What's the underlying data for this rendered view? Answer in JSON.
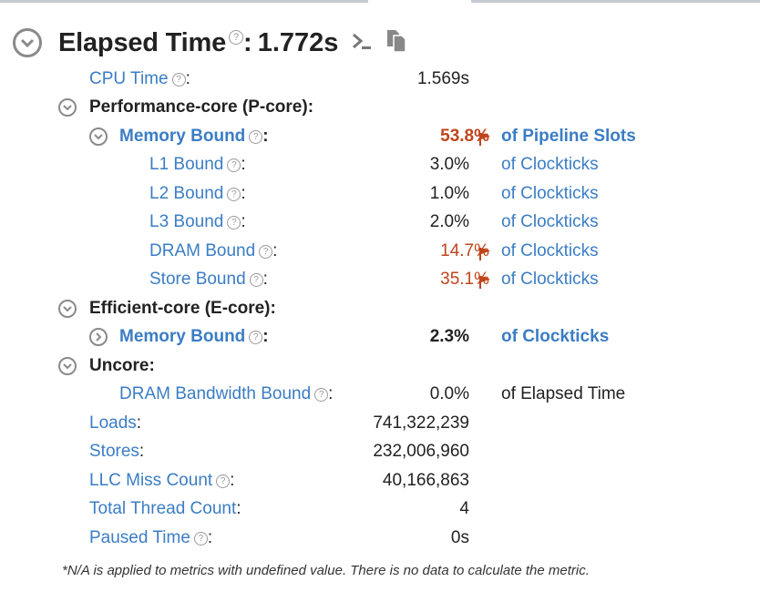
{
  "header": {
    "title": "Elapsed Time",
    "colon": ":",
    "value": "1.772s",
    "help": "?"
  },
  "rows": {
    "cpu_time": {
      "label": "CPU Time",
      "colon": ":",
      "value": "1.569s"
    },
    "pcore": {
      "label": "Performance-core (P-core):"
    },
    "pcore_mem": {
      "label": "Memory Bound",
      "colon": ":",
      "value": "53.8%",
      "unit": "of Pipeline Slots"
    },
    "l1": {
      "label": "L1 Bound",
      "colon": ":",
      "value": "3.0%",
      "unit": "of Clockticks"
    },
    "l2": {
      "label": "L2 Bound",
      "colon": ":",
      "value": "1.0%",
      "unit": "of Clockticks"
    },
    "l3": {
      "label": "L3 Bound",
      "colon": ":",
      "value": "2.0%",
      "unit": "of Clockticks"
    },
    "dram": {
      "label": "DRAM Bound",
      "colon": ":",
      "value": "14.7%",
      "unit": "of Clockticks"
    },
    "store": {
      "label": "Store Bound",
      "colon": ":",
      "value": "35.1%",
      "unit": "of Clockticks"
    },
    "ecore": {
      "label": "Efficient-core (E-core):"
    },
    "ecore_mem": {
      "label": "Memory Bound",
      "colon": ":",
      "value": "2.3%",
      "unit": "of Clockticks"
    },
    "uncore": {
      "label": "Uncore:"
    },
    "dram_bw": {
      "label": "DRAM Bandwidth Bound",
      "colon": ":",
      "value": "0.0%",
      "unit": "of Elapsed Time"
    },
    "loads": {
      "label": "Loads",
      "colon": ":",
      "value": "741,322,239"
    },
    "stores": {
      "label": "Stores",
      "colon": ":",
      "value": "232,006,960"
    },
    "llc": {
      "label": "LLC Miss Count",
      "colon": ":",
      "value": "40,166,863"
    },
    "threads": {
      "label": "Total Thread Count",
      "colon": ":",
      "value": "4"
    },
    "paused": {
      "label": "Paused Time",
      "colon": ":",
      "value": "0s"
    }
  },
  "footnote": "*N/A is applied to metrics with undefined value. There is no data to calculate the metric.",
  "colors": {
    "link": "#3b7dc4",
    "warning": "#c0441b",
    "text": "#222222"
  },
  "icons": [
    "collapse-chevron-icon",
    "help-icon",
    "terminal-icon",
    "copy-icon",
    "expand-chevron-icon",
    "flag-icon"
  ]
}
